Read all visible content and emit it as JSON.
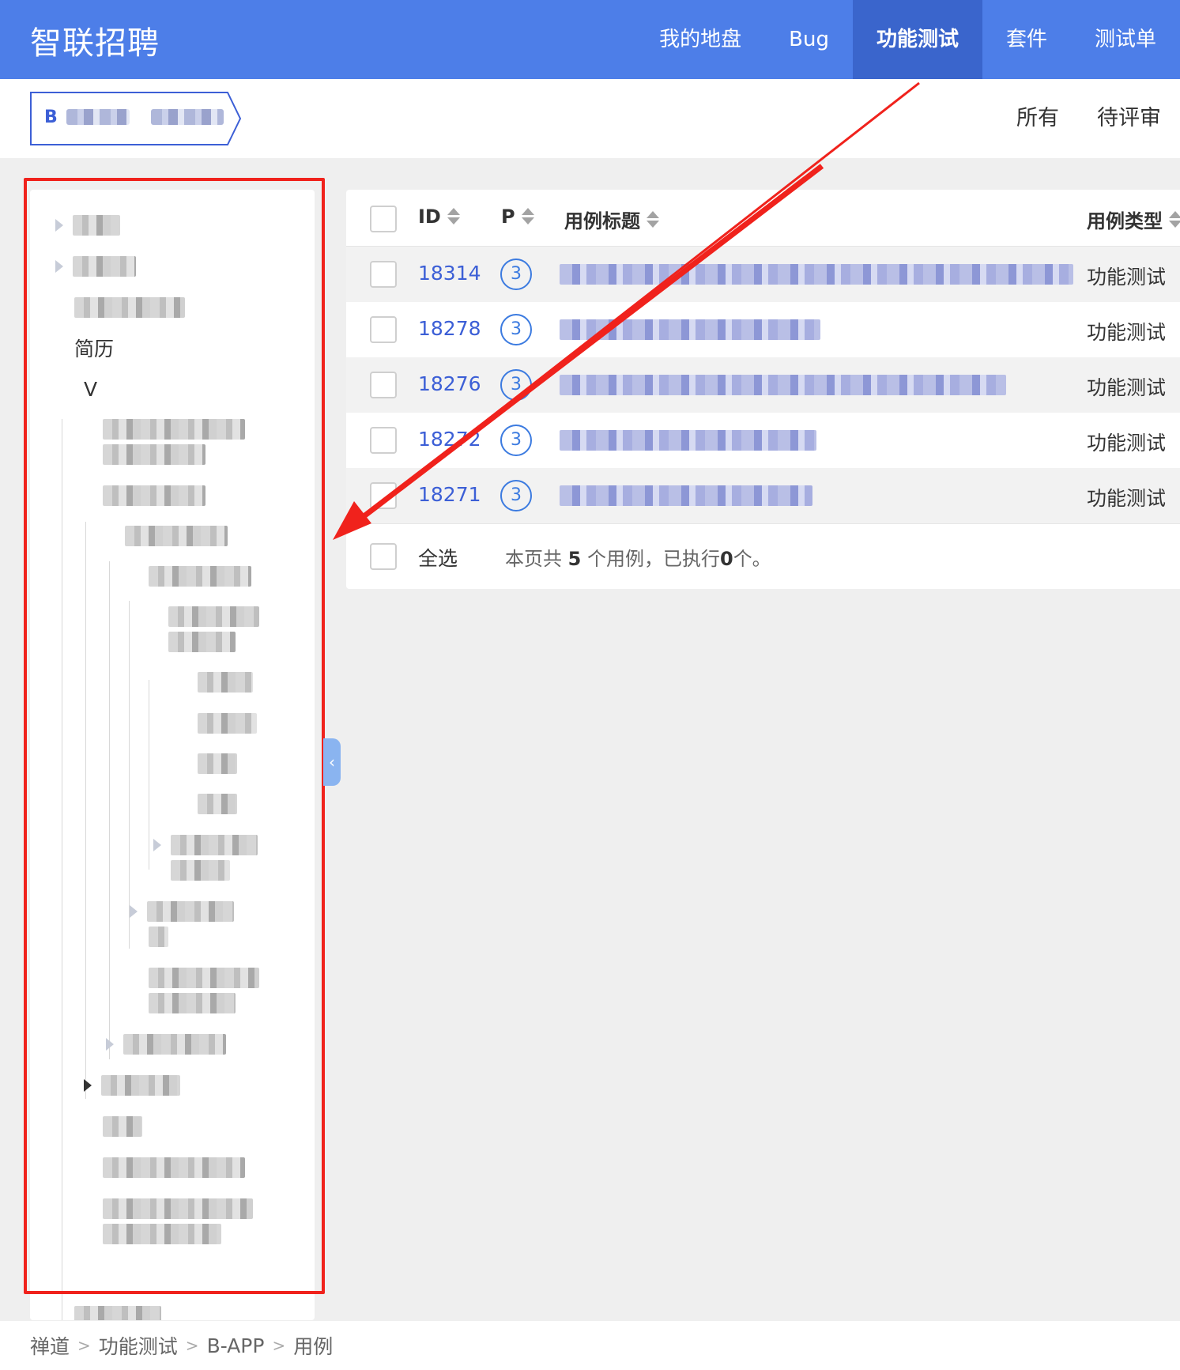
{
  "header": {
    "brand": "智联招聘",
    "nav": [
      "我的地盘",
      "Bug",
      "功能测试",
      "套件",
      "测试单"
    ],
    "active_nav": "功能测试"
  },
  "subheader": {
    "product_prefix": "B",
    "tabs": [
      "所有",
      "待评审"
    ]
  },
  "tree": {
    "visible_labels": [
      "简历",
      "V"
    ]
  },
  "table": {
    "columns": {
      "id": "ID",
      "pri": "P",
      "title": "用例标题",
      "type": "用例类型"
    },
    "rows": [
      {
        "id": "18314",
        "pri": "3",
        "type": "功能测试"
      },
      {
        "id": "18278",
        "pri": "3",
        "type": "功能测试"
      },
      {
        "id": "18276",
        "pri": "3",
        "type": "功能测试"
      },
      {
        "id": "18272",
        "pri": "3",
        "type": "功能测试"
      },
      {
        "id": "18271",
        "pri": "3",
        "type": "功能测试"
      }
    ],
    "footer": {
      "select_all": "全选",
      "summary_pre": "本页共 ",
      "summary_count": "5",
      "summary_mid": " 个用例，已执行",
      "summary_exec": "0",
      "summary_post": "个。"
    }
  },
  "breadcrumb": [
    "禅道",
    "功能测试",
    "B-APP",
    "用例"
  ],
  "colors": {
    "header": "#4d7ee8",
    "active_nav": "#3a65cc",
    "link": "#3c5fd6",
    "annotation": "#f0221c"
  }
}
